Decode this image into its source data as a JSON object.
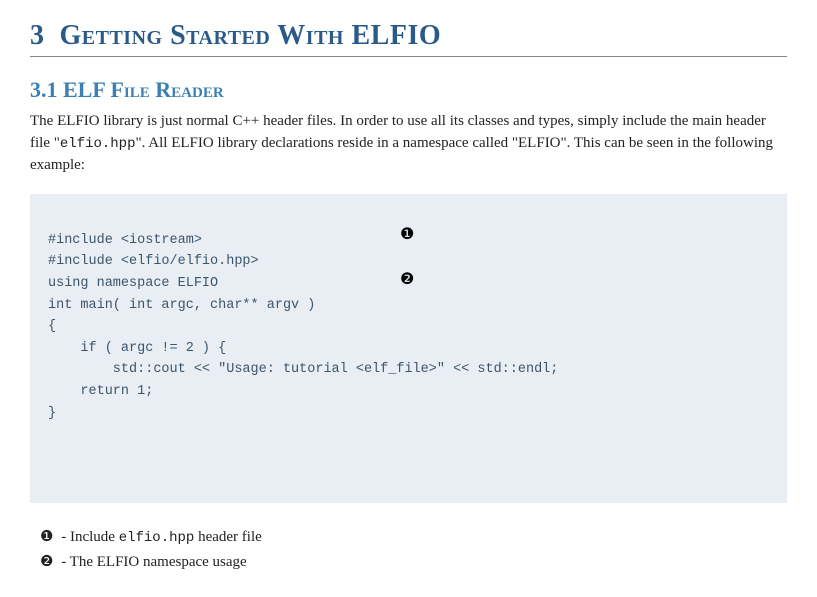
{
  "chapter": {
    "number": "3",
    "title_rest": "Getting Started With ELFIO"
  },
  "section": {
    "number": "3.1",
    "title_rest": "ELF File Reader"
  },
  "paragraph": {
    "part1": "The ELFIO library is just normal C++ header files. In order to use all its classes and types, simply include the main header file \"",
    "code1": "elfio.hpp",
    "part2": "\". All ELFIO library declarations reside in a namespace called \"ELFIO\". This can be seen in the following example:"
  },
  "code": {
    "l1": "#include <iostream>",
    "l2": "#include <elfio/elfio.hpp>",
    "l3": "",
    "l4": "using namespace ELFIO",
    "l5": "",
    "l6": "int main( int argc, char** argv )",
    "l7": "{",
    "l8": "    if ( argc != 2 ) {",
    "l9": "        std::cout << \"Usage: tutorial <elf_file>\" << std::endl;",
    "l10": "    return 1;",
    "l11": "}"
  },
  "markers": {
    "m1": "❶",
    "m2": "❷"
  },
  "callouts": {
    "c1_num": "❶",
    "c1_pre": " - Include ",
    "c1_code": "elfio.hpp",
    "c1_post": " header file",
    "c2_num": "❷",
    "c2_text": " - The ELFIO namespace usage"
  }
}
